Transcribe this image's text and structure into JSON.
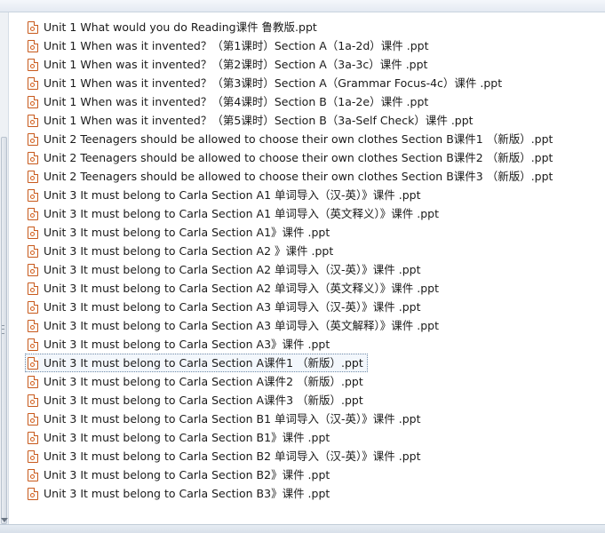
{
  "files": [
    {
      "name": "Unit 1 What would you do Reading课件 鲁教版.ppt",
      "icon": "ppt-file-icon"
    },
    {
      "name": "Unit 1 When was it invented？（第1课时）Section A（1a-2d）课件 .ppt",
      "icon": "ppt-file-icon"
    },
    {
      "name": "Unit 1 When was it invented？（第2课时）Section A（3a-3c）课件 .ppt",
      "icon": "ppt-file-icon"
    },
    {
      "name": "Unit 1 When was it invented？（第3课时）Section A（Grammar Focus-4c）课件 .ppt",
      "icon": "ppt-file-icon"
    },
    {
      "name": "Unit 1 When was it invented？（第4课时）Section B（1a-2e）课件 .ppt",
      "icon": "ppt-file-icon"
    },
    {
      "name": "Unit 1 When was it invented？（第5课时）Section B（3a-Self Check）课件 .ppt",
      "icon": "ppt-file-icon"
    },
    {
      "name": "Unit 2 Teenagers should be allowed to choose their own clothes Section B课件1 （新版）.ppt",
      "icon": "ppt-file-icon"
    },
    {
      "name": "Unit 2 Teenagers should be allowed to choose their own clothes Section B课件2 （新版）.ppt",
      "icon": "ppt-file-icon"
    },
    {
      "name": "Unit 2 Teenagers should be allowed to choose their own clothes Section B课件3 （新版）.ppt",
      "icon": "ppt-file-icon"
    },
    {
      "name": "Unit 3 It must belong to Carla Section A1 单词导入（汉-英）》课件 .ppt",
      "icon": "ppt-file-icon"
    },
    {
      "name": "Unit 3 It must belong to Carla Section A1 单词导入（英文释义）》课件 .ppt",
      "icon": "ppt-file-icon"
    },
    {
      "name": "Unit 3 It must belong to Carla Section A1》课件 .ppt",
      "icon": "ppt-file-icon"
    },
    {
      "name": "Unit 3 It must belong to Carla Section A2 》课件 .ppt",
      "icon": "ppt-file-icon"
    },
    {
      "name": "Unit 3 It must belong to Carla Section A2 单词导入（汉-英）》课件 .ppt",
      "icon": "ppt-file-icon"
    },
    {
      "name": "Unit 3 It must belong to Carla Section A2 单词导入（英文释义）》课件 .ppt",
      "icon": "ppt-file-icon"
    },
    {
      "name": "Unit 3 It must belong to Carla Section A3 单词导入（汉-英）》课件 .ppt",
      "icon": "ppt-file-icon"
    },
    {
      "name": "Unit 3 It must belong to Carla Section A3 单词导入（英文解释）》课件 .ppt",
      "icon": "ppt-file-icon"
    },
    {
      "name": "Unit 3 It must belong to Carla Section A3》课件 .ppt",
      "icon": "ppt-file-icon"
    },
    {
      "name": "Unit 3 It must belong to Carla Section A课件1 （新版）.ppt",
      "icon": "ppt-file-icon",
      "focused": true
    },
    {
      "name": "Unit 3 It must belong to Carla Section A课件2 （新版）.ppt",
      "icon": "ppt-file-icon"
    },
    {
      "name": "Unit 3 It must belong to Carla Section A课件3 （新版）.ppt",
      "icon": "ppt-file-icon"
    },
    {
      "name": "Unit 3 It must belong to Carla Section B1 单词导入（汉-英）》课件 .ppt",
      "icon": "ppt-file-icon"
    },
    {
      "name": "Unit 3 It must belong to Carla Section B1》课件 .ppt",
      "icon": "ppt-file-icon"
    },
    {
      "name": "Unit 3 It must belong to Carla Section B2 单词导入（汉-英）》课件 .ppt",
      "icon": "ppt-file-icon"
    },
    {
      "name": "Unit 3 It must belong to Carla Section B2》课件 .ppt",
      "icon": "ppt-file-icon"
    },
    {
      "name": "Unit 3 It must belong to Carla Section B3》课件 .ppt",
      "icon": "ppt-file-icon"
    }
  ],
  "colors": {
    "icon_accent": "#c85a1e",
    "focus_border": "#6f8aa8"
  }
}
